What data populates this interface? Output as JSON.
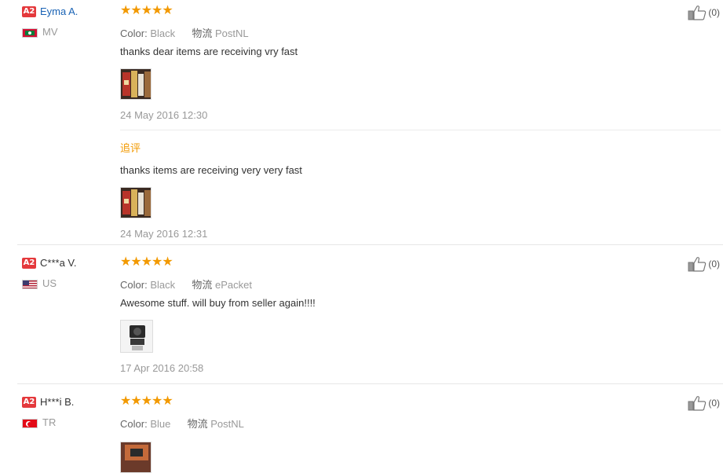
{
  "reviews": [
    {
      "level": "A2",
      "name": "Eyma A.",
      "country": "MV",
      "stars": "★★★★★",
      "color_label": "Color:",
      "color_value": "Black",
      "shipping_label": "物流",
      "shipping_value": "PostNL",
      "text": "thanks dear items are receiving vry fast",
      "date": "24 May 2016 12:30",
      "helpful": "(0)",
      "followup": {
        "label": "追评",
        "text": "thanks items are receiving very very fast",
        "date": "24 May 2016 12:31"
      }
    },
    {
      "level": "A2",
      "name": "C***a V.",
      "country": "US",
      "stars": "★★★★★",
      "color_label": "Color:",
      "color_value": "Black",
      "shipping_label": "物流",
      "shipping_value": "ePacket",
      "text": "Awesome stuff. will buy from seller again!!!!",
      "date": "17 Apr 2016 20:58",
      "helpful": "(0)"
    },
    {
      "level": "A2",
      "name": "H***i B.",
      "country": "TR",
      "stars": "★★★★★",
      "color_label": "Color:",
      "color_value": "Blue",
      "shipping_label": "物流",
      "shipping_value": "PostNL",
      "helpful": "(0)"
    }
  ],
  "icons": {
    "like": "thumbs-up-icon",
    "flag_mv": "maldives-flag-icon",
    "flag_us": "usa-flag-icon",
    "flag_tr": "turkey-flag-icon"
  },
  "colors": {
    "star": "#f29900",
    "badge": "#e4393c",
    "name_link": "#1a63b5",
    "followup_label": "#f29900"
  }
}
